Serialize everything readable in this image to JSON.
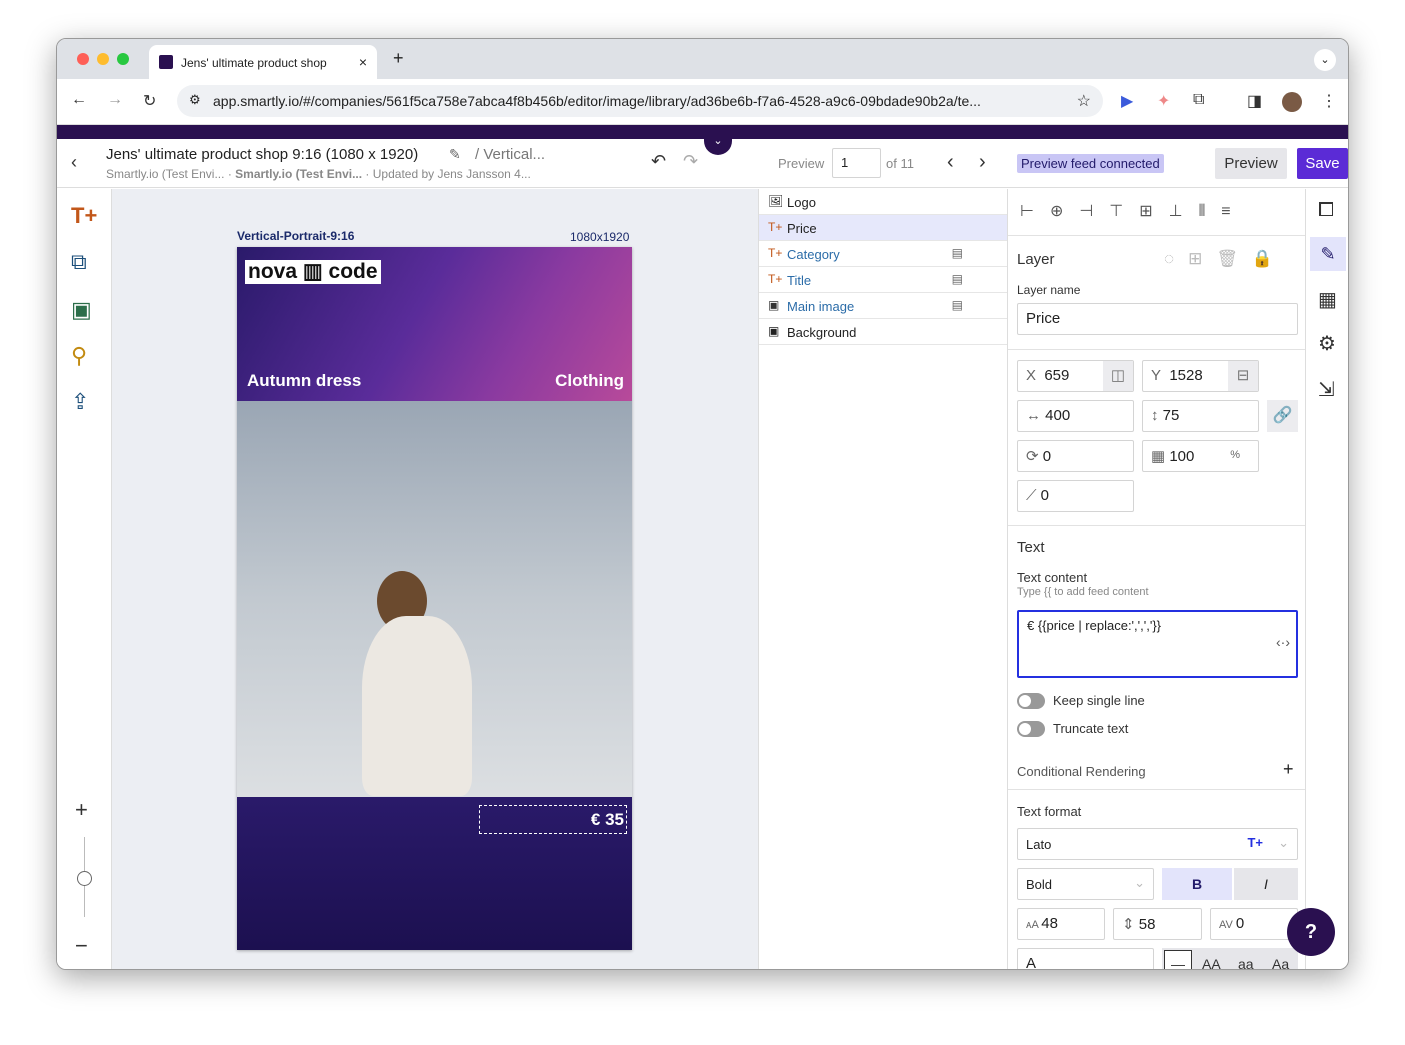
{
  "browser": {
    "tab_title": "Jens' ultimate product shop",
    "url": "app.smartly.io/#/companies/561f5ca758e7abca4f8b456b/editor/image/library/ad36be6b-f7a6-4528-a9c6-09bdade90b2a/te..."
  },
  "header": {
    "title": "Jens' ultimate product shop 9:16 (1080 x 1920)",
    "crumb": "/ Vertical...",
    "sub1": "Smartly.io (Test Envi...",
    "sub2": "Smartly.io (Test Envi...",
    "sub3": "Updated by Jens Jansson 4...",
    "preview_label": "Preview",
    "preview_value": "1",
    "of": "of 11",
    "feed_badge": "Preview feed connected",
    "preview_button": "Preview",
    "save_button": "Save"
  },
  "canvas": {
    "name": "Vertical-Portrait-9:16",
    "size": "1080x1920",
    "logo": "nova ▥ code",
    "product": "Autumn dress",
    "category": "Clothing",
    "price": "€ 35"
  },
  "layers": [
    {
      "label": "Logo",
      "icon": "image",
      "feed": false
    },
    {
      "label": "Price",
      "icon": "text",
      "feed": false,
      "selected": true
    },
    {
      "label": "Category",
      "icon": "text",
      "feed": true
    },
    {
      "label": "Title",
      "icon": "text",
      "feed": true
    },
    {
      "label": "Main image",
      "icon": "image",
      "feed": true
    },
    {
      "label": "Background",
      "icon": "image",
      "feed": false
    }
  ],
  "props": {
    "layer_title": "Layer",
    "layer_name_label": "Layer name",
    "layer_name": "Price",
    "x": "659",
    "y": "1528",
    "w": "400",
    "h": "75",
    "rotation": "0",
    "opacity": "100",
    "opacity_unit": "%",
    "skew": "0",
    "text_title": "Text",
    "text_content_label": "Text content",
    "text_content_hint": "Type {{ to add feed content",
    "text_content": "€ {{price | replace:',',','}}",
    "keep_single_line": "Keep single line",
    "truncate_text": "Truncate text",
    "conditional": "Conditional Rendering",
    "text_format": "Text format",
    "font": "Lato",
    "weight": "Bold",
    "bold": "B",
    "italic": "I",
    "font_size": "48",
    "line_height": "58",
    "letter_spacing": "0",
    "case_a": "A",
    "case_none": "—",
    "case_upper": "AA",
    "case_lower": "aa",
    "case_title": "Aa"
  },
  "colors": {
    "brand": "#2a1050",
    "accent": "#5b2bd6",
    "badge": "#c9c6f5"
  }
}
